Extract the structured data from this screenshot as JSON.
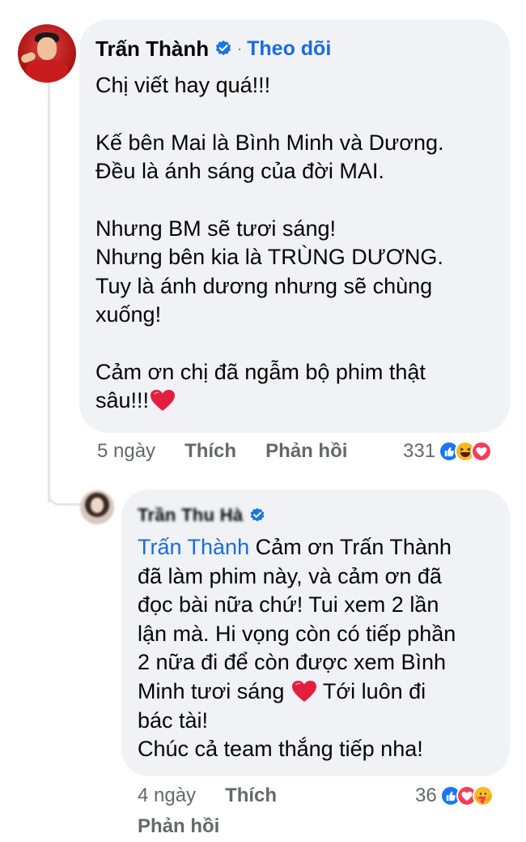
{
  "comment": {
    "author": "Trấn Thành",
    "follow_label": "Theo dõi",
    "dot": "·",
    "lines": [
      "Chị viết hay quá!!!",
      "",
      "Kế bên Mai là Bình Minh và Dương.",
      "Đều là ánh sáng của đời MAI.",
      "",
      "Nhưng BM sẽ tươi sáng!",
      "Nhưng bên kia là TRÙNG DƯƠNG.",
      "Tuy là ánh dương nhưng sẽ chùng",
      "xuống!",
      "",
      "Cảm ơn chị đã ngẫm bộ phim thật"
    ],
    "last_line": "sâu!!!",
    "time": "5 ngày",
    "like_label": "Thích",
    "reply_label": "Phản hồi",
    "reaction_count": "331",
    "reactions": [
      "like-icon",
      "haha-icon",
      "love-icon"
    ]
  },
  "reply": {
    "author": "Trần Thu Hà",
    "mention": "Trấn Thành",
    "lines": [
      " Cảm ơn Trấn Thành",
      "đã làm phim này, và cảm ơn đã",
      "đọc bài nữa chứ! Tui xem 2 lần",
      "lận mà. Hi vọng còn có tiếp phần",
      "2 nữa đi để còn được xem Bình"
    ],
    "line_before_heart": "Minh tươi sáng ",
    "line_after_heart": " Tới luôn đi",
    "lines_end": [
      "bác tài!",
      "Chúc cả team thắng tiếp nha!"
    ],
    "time": "4 ngày",
    "like_label": "Thích",
    "reply_label": "Phản hồi",
    "reaction_count": "36",
    "reactions": [
      "like-icon",
      "love-icon",
      "care-icon"
    ]
  },
  "colors": {
    "link_blue": "#1b6bdd",
    "bubble_bg": "#f0f2f5",
    "meta_gray": "#65676b",
    "heart_red": "#e41e3f"
  }
}
